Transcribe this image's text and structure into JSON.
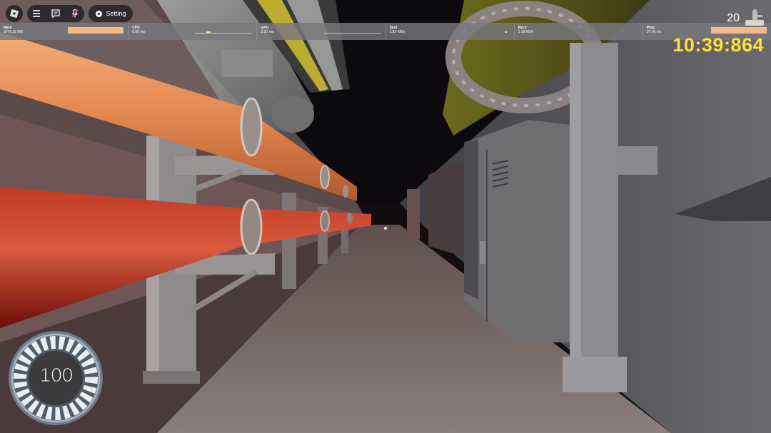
{
  "topbar": {
    "setting_label": "Setting",
    "icons": [
      "roblox-icon",
      "menu-icon",
      "chat-icon",
      "mic-off-icon",
      "gear-icon"
    ]
  },
  "stats": [
    {
      "name": "Mem",
      "value": "3776.26 MB",
      "bar": true
    },
    {
      "name": "CPU",
      "value": "5.00 ms",
      "graph": true
    },
    {
      "name": "GPU",
      "value": "3.25 ms",
      "graph": true
    },
    {
      "name": "Sent",
      "value": "1.82 KB/s",
      "graph": true
    },
    {
      "name": "Recv",
      "value": "1.18 KB/s"
    },
    {
      "name": "Ping",
      "value": "97.00 ms",
      "bar": true
    }
  ],
  "hud": {
    "lives_count": "20",
    "timer": "10:39:864",
    "gauge_value": "100",
    "gauge_color": "#ffffff"
  },
  "colors": {
    "timer": "#ffe234",
    "stat_bar": "#f3ba88",
    "orange_pipe": "#e8935e",
    "red_pipe": "#a81c10"
  }
}
